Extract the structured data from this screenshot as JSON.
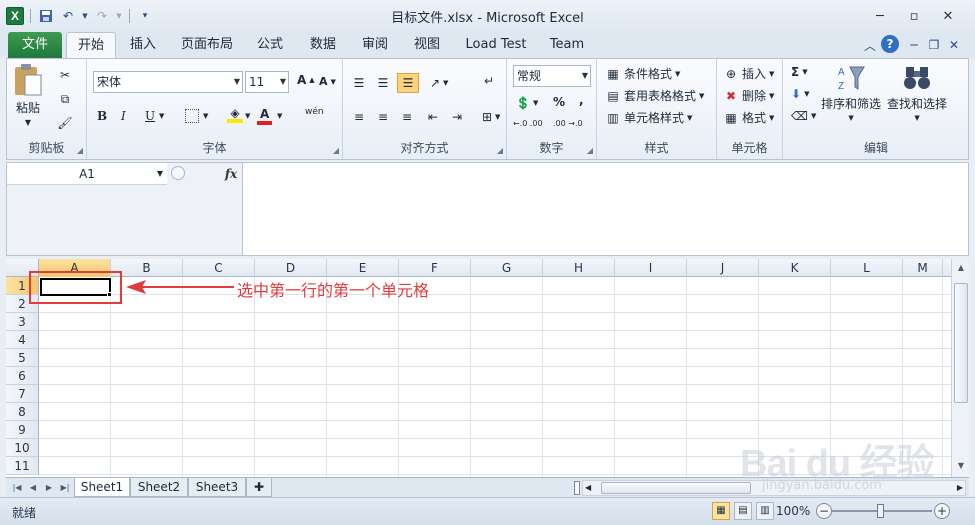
{
  "window": {
    "title": "目标文件.xlsx - Microsoft Excel"
  },
  "tabs": {
    "file": "文件",
    "home": "开始",
    "insert": "插入",
    "page_layout": "页面布局",
    "formulas": "公式",
    "data": "数据",
    "review": "审阅",
    "view": "视图",
    "load_test": "Load Test",
    "team": "Team"
  },
  "ribbon": {
    "clipboard": {
      "label": "剪贴板",
      "paste": "粘贴"
    },
    "font": {
      "label": "字体",
      "font_name": "宋体",
      "font_size": "11",
      "bold": "B",
      "italic": "I",
      "underline": "U",
      "phonetic": "wén"
    },
    "alignment": {
      "label": "对齐方式"
    },
    "number": {
      "label": "数字",
      "format": "常规",
      "percent": "%",
      "comma": ",",
      "inc_decimal": "←.0 .00",
      "dec_decimal": ".00 →.0"
    },
    "styles": {
      "label": "样式",
      "conditional": "条件格式",
      "table": "套用表格格式",
      "cell_styles": "单元格样式"
    },
    "cells": {
      "label": "单元格",
      "insert": "插入",
      "delete": "删除",
      "format": "格式"
    },
    "editing": {
      "label": "编辑",
      "sort_filter": "排序和筛选",
      "find_select": "查找和选择"
    }
  },
  "formula_bar": {
    "name_box": "A1",
    "fx": "fx",
    "content": ""
  },
  "grid": {
    "columns": [
      "A",
      "B",
      "C",
      "D",
      "E",
      "F",
      "G",
      "H",
      "I",
      "J",
      "K",
      "L",
      "M"
    ],
    "rows": [
      "1",
      "2",
      "3",
      "4",
      "5",
      "6",
      "7",
      "8",
      "9",
      "10",
      "11"
    ],
    "active_cell": "A1",
    "annotation": "选中第一行的第一个单元格"
  },
  "sheets": {
    "tabs": [
      "Sheet1",
      "Sheet2",
      "Sheet3"
    ],
    "active_index": 0
  },
  "status": {
    "ready": "就绪",
    "zoom": "100%"
  },
  "watermark": {
    "text": "Bai du 经验",
    "url": "jingyan.baidu.com"
  },
  "colors": {
    "file_tab": "#1f7a3d",
    "selection_header": "#f5c76a",
    "annotation_red": "#e23b3b"
  }
}
